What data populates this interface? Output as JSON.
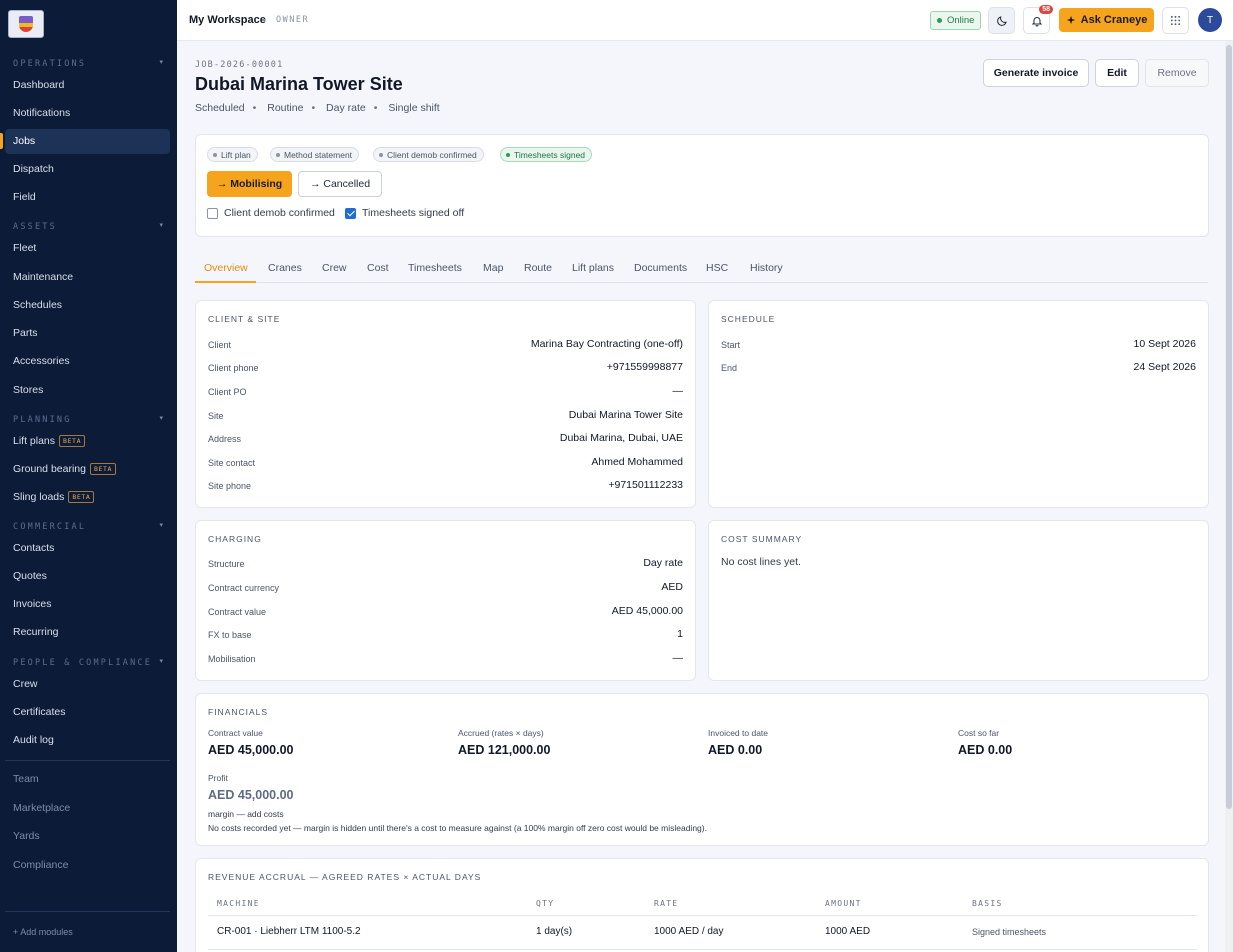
{
  "sidebar": {
    "sections": [
      {
        "title": "OPERATIONS",
        "items": [
          "Dashboard",
          "Notifications",
          "Jobs",
          "Dispatch",
          "Field"
        ]
      },
      {
        "title": "ASSETS",
        "items": [
          "Fleet",
          "Maintenance",
          "Schedules",
          "Parts",
          "Accessories",
          "Stores"
        ]
      },
      {
        "title": "PLANNING",
        "items": [
          "Lift plans",
          "Ground bearing",
          "Sling loads"
        ]
      },
      {
        "title": "COMMERCIAL",
        "items": [
          "Contacts",
          "Quotes",
          "Invoices",
          "Recurring"
        ]
      },
      {
        "title": "PEOPLE & COMPLIANCE",
        "items": [
          "Crew",
          "Certificates",
          "Audit log"
        ]
      }
    ],
    "caret": "▾",
    "beta_label": "BETA",
    "extra_items": [
      "Team",
      "Marketplace",
      "Yards",
      "Compliance"
    ],
    "add_modules": "+ Add modules",
    "active_item": "Jobs"
  },
  "topbar": {
    "workspace": "My Workspace",
    "separator": "·",
    "role": "OWNER",
    "status": "Online",
    "notification_count": "58",
    "ask_label": "Ask Craneye",
    "avatar_initial": "T"
  },
  "job": {
    "id": "JOB-2026-00001",
    "title": "Dubai Marina Tower Site",
    "meta": [
      "Scheduled",
      "Routine",
      "Day rate",
      "Single shift"
    ],
    "actions": {
      "invoice": "Generate invoice",
      "edit": "Edit",
      "remove": "Remove"
    }
  },
  "status_card": {
    "chips": [
      {
        "label": "Lift plan",
        "state": "pending"
      },
      {
        "label": "Method statement",
        "state": "pending"
      },
      {
        "label": "Client demob confirmed",
        "state": "pending"
      },
      {
        "label": "Timesheets signed",
        "state": "done"
      }
    ],
    "transitions": {
      "primary": "→ Mobilising",
      "secondary": "→ Cancelled"
    },
    "checks": [
      {
        "label": "Client demob confirmed",
        "checked": false
      },
      {
        "label": "Timesheets signed off",
        "checked": true
      }
    ]
  },
  "tabs": [
    "Overview",
    "Cranes",
    "Crew",
    "Cost",
    "Timesheets",
    "Map",
    "Route",
    "Lift plans",
    "Documents",
    "HSC",
    "History"
  ],
  "client_site": {
    "title": "CLIENT & SITE",
    "rows": [
      {
        "label": "Client",
        "value": "Marina Bay Contracting (one-off)"
      },
      {
        "label": "Client phone",
        "value": "+971559998877"
      },
      {
        "label": "Client PO",
        "value": "—"
      },
      {
        "label": "Site",
        "value": "Dubai Marina Tower Site"
      },
      {
        "label": "Address",
        "value": "Dubai Marina, Dubai, UAE"
      },
      {
        "label": "Site contact",
        "value": "Ahmed Mohammed"
      },
      {
        "label": "Site phone",
        "value": "+971501112233"
      }
    ]
  },
  "schedule": {
    "title": "SCHEDULE",
    "rows": [
      {
        "label": "Start",
        "value": "10 Sept 2026"
      },
      {
        "label": "End",
        "value": "24 Sept 2026"
      }
    ]
  },
  "charging": {
    "title": "CHARGING",
    "rows": [
      {
        "label": "Structure",
        "value": "Day rate"
      },
      {
        "label": "Contract currency",
        "value": "AED"
      },
      {
        "label": "Contract value",
        "value": "AED 45,000.00"
      },
      {
        "label": "FX to base",
        "value": "1"
      },
      {
        "label": "Mobilisation",
        "value": "—"
      }
    ]
  },
  "cost_summary": {
    "title": "COST SUMMARY",
    "empty": "No cost lines yet."
  },
  "financials": {
    "title": "FINANCIALS",
    "items": [
      {
        "label": "Contract value",
        "value": "AED 45,000.00"
      },
      {
        "label": "Accrued (rates × days)",
        "value": "AED 121,000.00"
      },
      {
        "label": "Invoiced to date",
        "value": "AED 0.00"
      },
      {
        "label": "Cost so far",
        "value": "AED 0.00"
      }
    ],
    "profit_label": "Profit",
    "profit_value": "AED 45,000.00",
    "margin_note": "margin — add costs",
    "footnote": "No costs recorded yet — margin is hidden until there's a cost to measure against (a 100% margin off zero cost would be misleading)."
  },
  "revenue": {
    "title": "REVENUE ACCRUAL — AGREED RATES × ACTUAL DAYS",
    "columns": [
      "MACHINE",
      "QTY",
      "RATE",
      "AMOUNT",
      "BASIS"
    ],
    "rows": [
      {
        "machine": "CR-001 · Liebherr LTM 1100-5.2",
        "qty": "1 day(s)",
        "rate": "1000 AED / day",
        "amount": "1000 AED",
        "basis": "Signed timesheets"
      }
    ]
  },
  "colors": {
    "accent": "#f6a41d",
    "sidebar": "#0c1c38",
    "success": "#2e9b57",
    "danger": "#e0453c"
  }
}
